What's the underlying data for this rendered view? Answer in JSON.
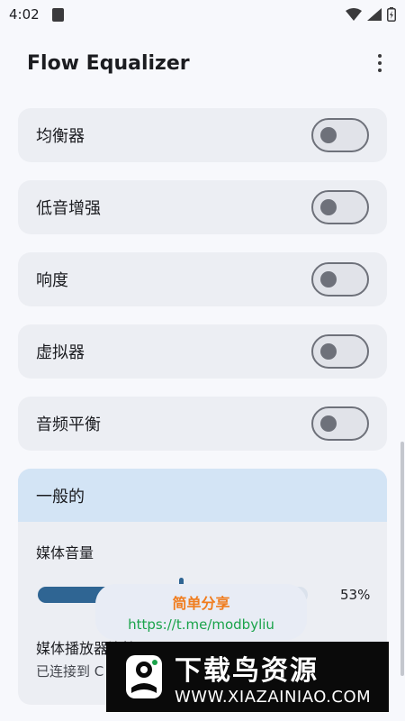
{
  "status_bar": {
    "time": "4:02",
    "icons": [
      "notification-icon",
      "wifi-icon",
      "signal-icon",
      "battery-icon"
    ]
  },
  "app_bar": {
    "title": "Flow Equalizer",
    "menu_icon": "more-vert-icon"
  },
  "toggles": [
    {
      "label": "均衡器",
      "enabled": false
    },
    {
      "label": "低音增强",
      "enabled": false
    },
    {
      "label": "响度",
      "enabled": false
    },
    {
      "label": "虚拟器",
      "enabled": false
    },
    {
      "label": "音频平衡",
      "enabled": false
    }
  ],
  "general": {
    "title": "一般的",
    "media_volume_label": "媒体音量",
    "media_volume_value": 53,
    "media_volume_text": "53%",
    "player_title": "媒体播放器连接",
    "player_status": "已连接到 C"
  },
  "share_overlay": {
    "title": "简单分享",
    "link": "https://t.me/modbyliu"
  },
  "watermark": {
    "title": "下载鸟资源",
    "url": "WWW.XIAZAINIAO.COM"
  },
  "colors": {
    "accent": "#2f6593",
    "card": "#eceef3",
    "header": "#d3e4f5",
    "background": "#f7f8fc"
  }
}
